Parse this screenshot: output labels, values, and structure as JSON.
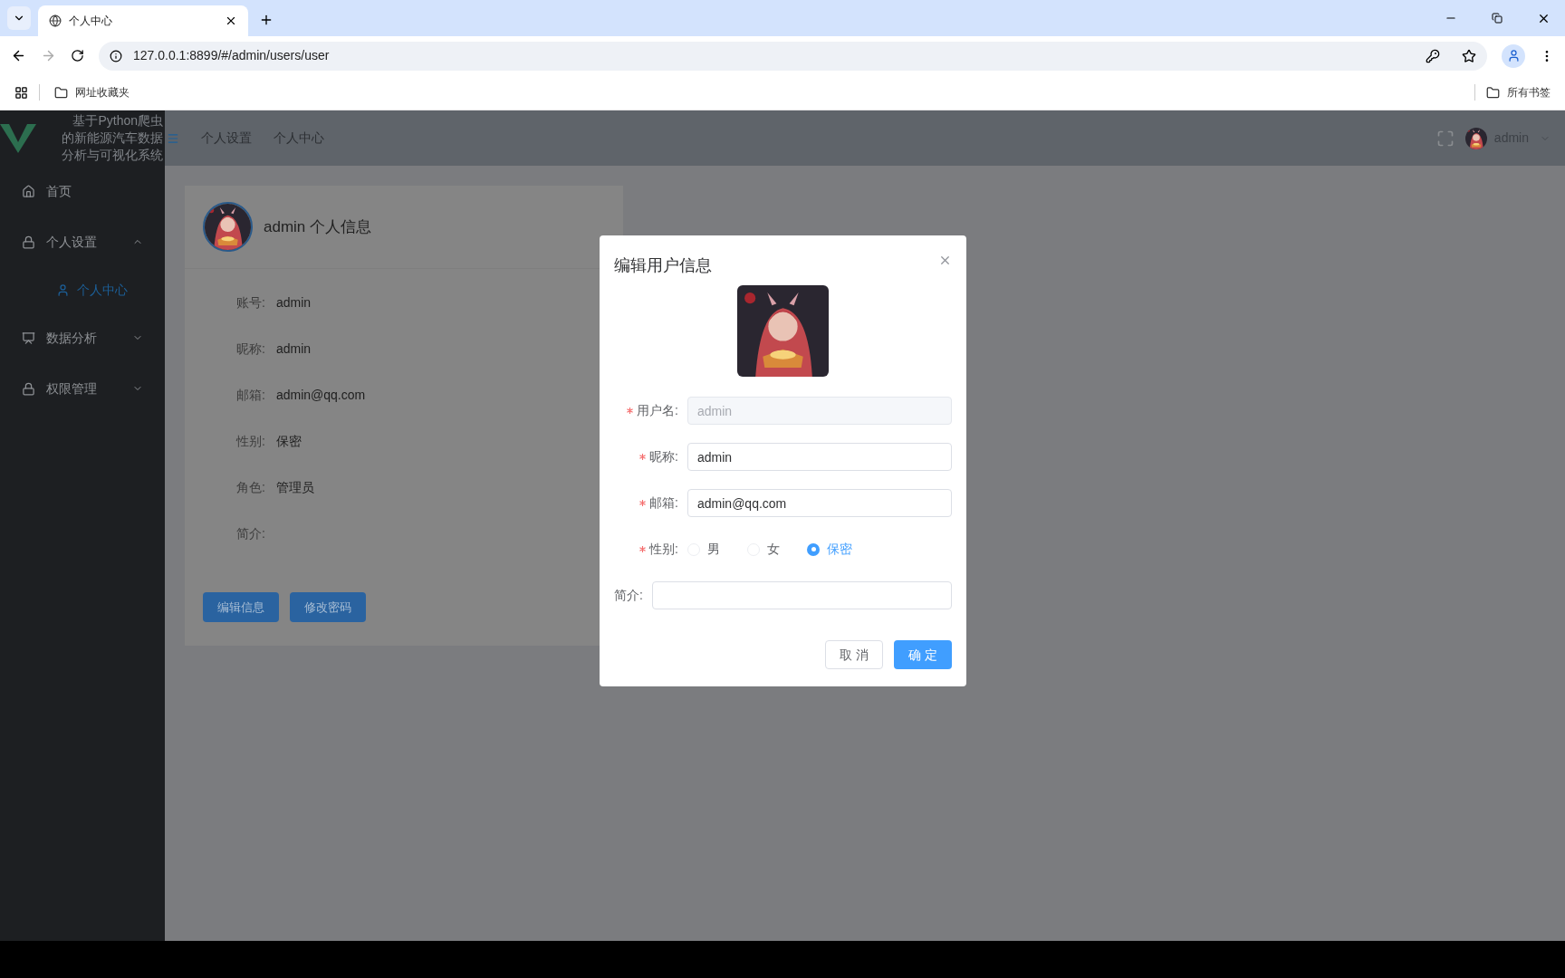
{
  "browser": {
    "tab_title": "个人中心",
    "url": "127.0.0.1:8899/#/admin/users/user",
    "bookmarks": [
      "网址收藏夹"
    ],
    "all_bookmarks": "所有书签"
  },
  "sidebar": {
    "title_lines": [
      "基于Python爬虫",
      "的新能源汽车数据",
      "分析与可视化系统"
    ],
    "items": [
      {
        "label": "首页",
        "kind": "item"
      },
      {
        "label": "个人设置",
        "kind": "submenu",
        "expanded": true,
        "children": [
          {
            "label": "个人中心",
            "selected": true
          }
        ]
      },
      {
        "label": "数据分析",
        "kind": "submenu",
        "expanded": false
      },
      {
        "label": "权限管理",
        "kind": "submenu",
        "expanded": false
      }
    ]
  },
  "header": {
    "breadcrumb": [
      "个人设置",
      "个人中心"
    ],
    "user": "admin"
  },
  "card": {
    "title": "admin 个人信息",
    "fields": [
      {
        "label": "账号:",
        "value": "admin"
      },
      {
        "label": "昵称:",
        "value": "admin"
      },
      {
        "label": "邮箱:",
        "value": "admin@qq.com"
      },
      {
        "label": "性别:",
        "value": "保密"
      },
      {
        "label": "角色:",
        "value": "管理员"
      },
      {
        "label": "简介:"
      }
    ],
    "buttons": [
      "编辑信息",
      "修改密码"
    ]
  },
  "dialog": {
    "title": "编辑用户信息",
    "fields": [
      {
        "kind": "text",
        "label": "用户名:",
        "required": true,
        "value": "admin",
        "disabled": true
      },
      {
        "kind": "text",
        "label": "昵称:",
        "required": true,
        "value": "admin",
        "disabled": false
      },
      {
        "kind": "text",
        "label": "邮箱:",
        "required": true,
        "value": "admin@qq.com",
        "disabled": false
      },
      {
        "kind": "radio",
        "label": "性别:",
        "required": true,
        "options": [
          {
            "label": "男",
            "selected": false
          },
          {
            "label": "女",
            "selected": false
          },
          {
            "label": "保密",
            "selected": true
          }
        ]
      },
      {
        "kind": "textarea",
        "label": "简介:",
        "required": false
      }
    ],
    "cancel": "取 消",
    "confirm": "确 定"
  }
}
